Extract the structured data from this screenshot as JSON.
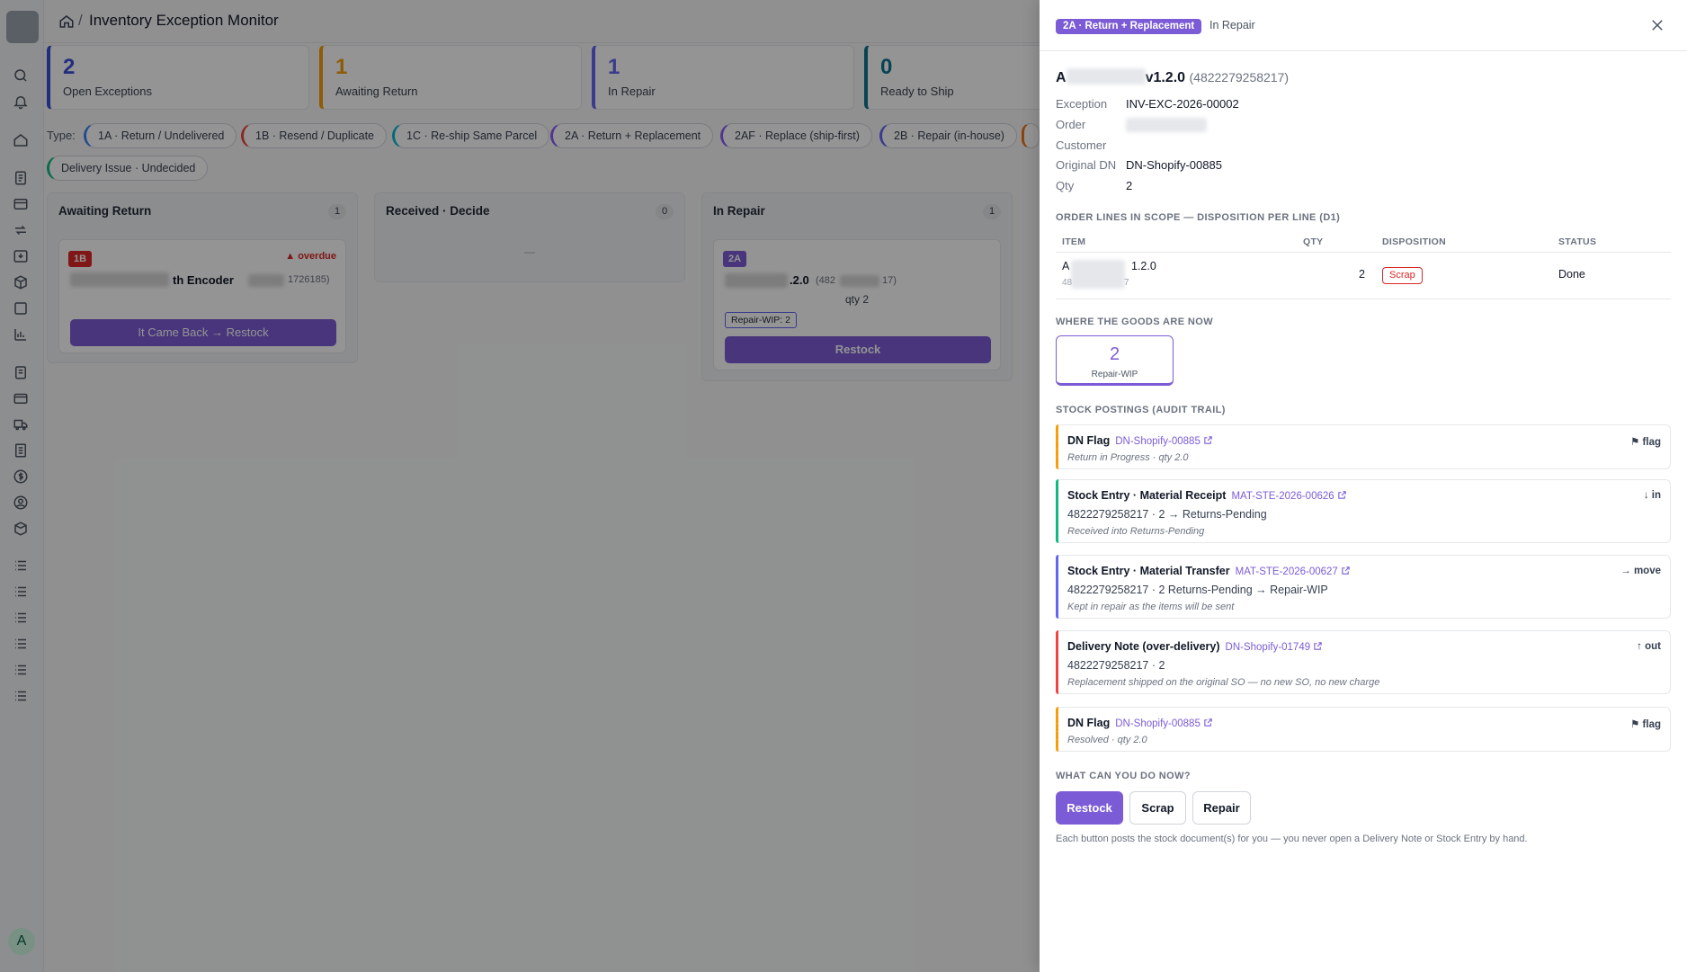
{
  "page": {
    "title": "Inventory Exception Monitor",
    "breadcrumb_sep": "/"
  },
  "kpis": [
    {
      "value": "2",
      "label": "Open Exceptions",
      "color": "#3b4fd8"
    },
    {
      "value": "1",
      "label": "Awaiting Return",
      "color": "#f59e0b"
    },
    {
      "value": "1",
      "label": "In Repair",
      "color": "#6366f1"
    },
    {
      "value": "0",
      "label": "Ready to Ship",
      "color": "#0e7490"
    }
  ],
  "filters": {
    "label": "Type:",
    "chips": [
      {
        "label": "1A · Return / Undelivered",
        "color": "#3b82f6"
      },
      {
        "label": "1B · Resend / Duplicate",
        "color": "#ef4444"
      },
      {
        "label": "1C · Re-ship Same Parcel",
        "color": "#06b6d4"
      },
      {
        "label": "2A · Return + Replacement",
        "color": "#8b5cf6"
      },
      {
        "label": "2AF · Replace (ship-first)",
        "color": "#8b5cf6"
      },
      {
        "label": "2B · Repair (in-house)",
        "color": "#6366f1"
      },
      {
        "label": "Delivery Issue · Undecided",
        "color": "#10b981"
      }
    ]
  },
  "board": {
    "columns": [
      {
        "title": "Awaiting Return",
        "count": "1"
      },
      {
        "title": "Received · Decide",
        "count": "0",
        "empty": "—"
      },
      {
        "title": "In Repair",
        "count": "1"
      }
    ],
    "awaiting_card": {
      "badge": "1B",
      "overdue": "overdue",
      "item_suffix": "th Encoder",
      "item_code_suffix": "1726185)",
      "action": "It Came Back → Restock"
    },
    "repair_card": {
      "badge": "2A",
      "item_suffix": ".2.0",
      "code_prefix": "(482",
      "code_suffix": "17)",
      "qty": "qty 2",
      "location_tag": "Repair-WIP: 2",
      "action": "Restock"
    }
  },
  "drawer": {
    "type_badge": "2A · Return + Replacement",
    "status": "In Repair",
    "title_prefix": "A",
    "title_suffix": "v1.2.0",
    "title_code": "(4822279258217)",
    "details": [
      {
        "key": "Exception",
        "value": "INV-EXC-2026-00002"
      },
      {
        "key": "Order",
        "value": ""
      },
      {
        "key": "Customer",
        "value": ""
      },
      {
        "key": "Original DN",
        "value": "DN-Shopify-00885"
      },
      {
        "key": "Qty",
        "value": "2"
      }
    ],
    "lines_section": "ORDER LINES IN SCOPE — DISPOSITION PER LINE (D1)",
    "lines_headers": {
      "item": "ITEM",
      "qty": "QTY",
      "disposition": "DISPOSITION",
      "status": "STATUS"
    },
    "lines": [
      {
        "item_prefix": "A",
        "item_suffix": "1.2.0",
        "code_prefix": "48",
        "code_suffix": "7",
        "qty": "2",
        "disposition": "Scrap",
        "status": "Done"
      }
    ],
    "location_section": "WHERE THE GOODS ARE NOW",
    "location": {
      "value": "2",
      "label": "Repair-WIP"
    },
    "postings_section": "STOCK POSTINGS (AUDIT TRAIL)",
    "postings": [
      {
        "title": "DN Flag",
        "link": "DN-Shopify-00885",
        "direction": "⚑ flag",
        "line2": "",
        "note": "Return in Progress · qty 2.0",
        "color": "#f59e0b",
        "dashed": true
      },
      {
        "title": "Stock Entry · Material Receipt",
        "link": "MAT-STE-2026-00626",
        "direction": "↓ in",
        "line2": "4822279258217 · 2 → Returns-Pending",
        "note": "Received into Returns-Pending",
        "color": "#10b981",
        "dashed": false
      },
      {
        "title": "Stock Entry · Material Transfer",
        "link": "MAT-STE-2026-00627",
        "direction": "→ move",
        "line2": "4822279258217 · 2 Returns-Pending → Repair-WIP",
        "note": "Kept in repair as the items will be sent",
        "color": "#6366f1",
        "dashed": false
      },
      {
        "title": "Delivery Note (over-delivery)",
        "link": "DN-Shopify-01749",
        "direction": "↑ out",
        "line2": "4822279258217 · 2",
        "note": "Replacement shipped on the original SO — no new SO, no new charge",
        "color": "#ef4444",
        "dashed": false
      },
      {
        "title": "DN Flag",
        "link": "DN-Shopify-00885",
        "direction": "⚑ flag",
        "line2": "",
        "note": "Resolved · qty 2.0",
        "color": "#f59e0b",
        "dashed": true
      }
    ],
    "actions_section": "WHAT CAN YOU DO NOW?",
    "actions": {
      "restock": "Restock",
      "scrap": "Scrap",
      "repair": "Repair"
    },
    "footnote": "Each button posts the stock document(s) for you — you never open a Delivery Note or Stock Entry by hand."
  },
  "user": {
    "avatar_initial": "A"
  },
  "colors": {
    "accent": "#7c5cd6",
    "danger": "#dc2626"
  }
}
